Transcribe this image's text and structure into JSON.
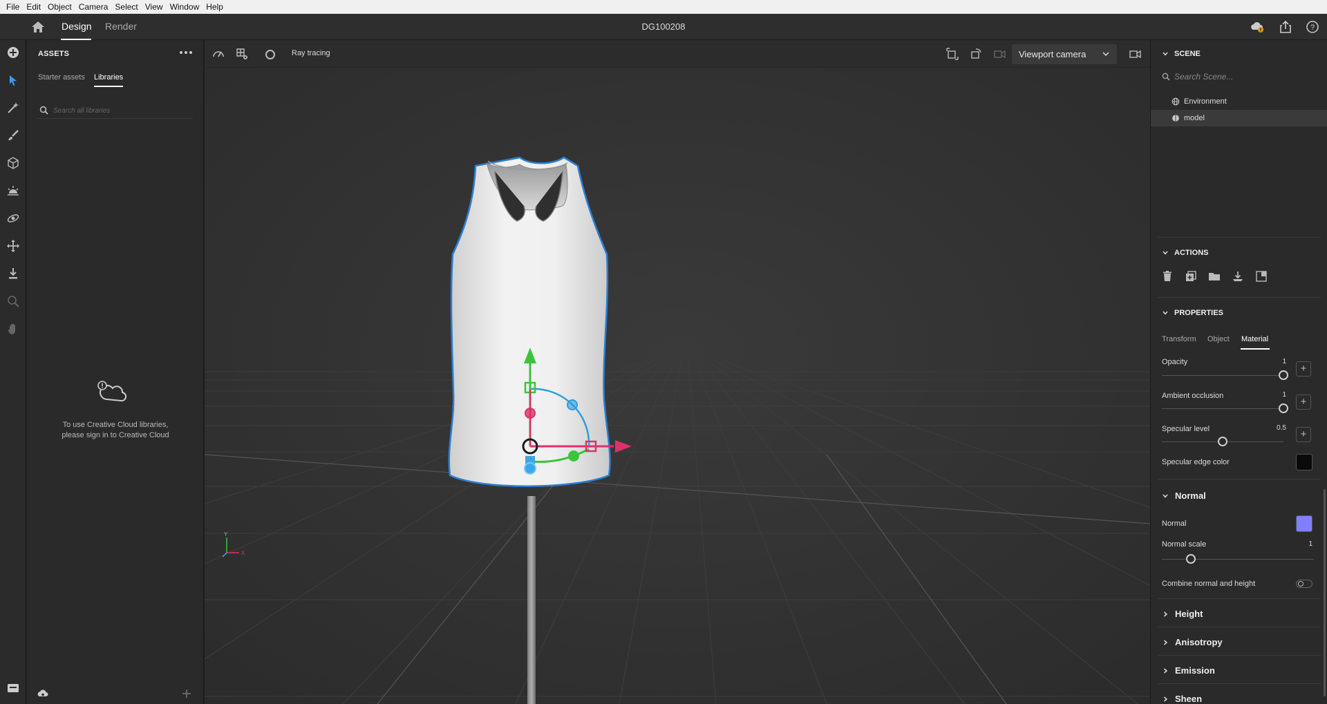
{
  "menu": [
    "File",
    "Edit",
    "Object",
    "Camera",
    "Select",
    "View",
    "Window",
    "Help"
  ],
  "titlebar": {
    "tabs": [
      "Design",
      "Render"
    ],
    "active_tab": "Design",
    "document_title": "DG100208"
  },
  "assets": {
    "title": "ASSETS",
    "tabs": [
      "Starter assets",
      "Libraries"
    ],
    "active_tab": "Libraries",
    "search_placeholder": "Search all libraries",
    "signin_line1": "To use Creative Cloud libraries,",
    "signin_line2": "please sign in to Creative Cloud"
  },
  "viewport": {
    "ray_tracing_label": "Ray tracing",
    "ray_tracing_on": false,
    "camera_select": "Viewport camera",
    "axis_labels": {
      "y": "Y",
      "x": "X"
    }
  },
  "scene": {
    "title": "SCENE",
    "search_placeholder": "Search Scene...",
    "items": [
      {
        "label": "Environment",
        "icon": "globe-icon",
        "selected": false
      },
      {
        "label": "model",
        "icon": "model-icon",
        "selected": true
      }
    ]
  },
  "actions": {
    "title": "ACTIONS",
    "icons": [
      "trash-icon",
      "duplicate-icon",
      "group-folder-icon",
      "drop-to-ground-icon",
      "export-icon"
    ]
  },
  "properties": {
    "title": "PROPERTIES",
    "tabs": [
      "Transform",
      "Object",
      "Material"
    ],
    "active_tab": "Material",
    "opacity": {
      "label": "Opacity",
      "value": "1"
    },
    "ambient_occlusion": {
      "label": "Ambient occlusion",
      "value": "1"
    },
    "specular_level": {
      "label": "Specular level",
      "value": "0.5"
    },
    "specular_edge_color": {
      "label": "Specular edge color",
      "color": "#0a0a0a"
    },
    "normal_group": "Normal",
    "normal": {
      "label": "Normal",
      "color": "#8080ff"
    },
    "normal_scale": {
      "label": "Normal scale",
      "value": "1"
    },
    "combine_normal_height": {
      "label": "Combine normal and height",
      "on": false
    },
    "collapsed_groups": [
      "Height",
      "Anisotropy",
      "Emission",
      "Sheen"
    ]
  },
  "colors": {
    "selection_outline": "#2a7fd4",
    "gizmo_y": "#3cc43c",
    "gizmo_x": "#e0306a",
    "gizmo_z": "#3aa8e8"
  }
}
